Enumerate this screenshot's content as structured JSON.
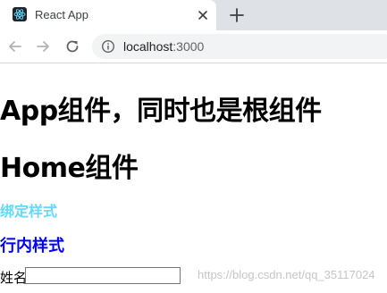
{
  "browser": {
    "tab": {
      "title": "React App",
      "favicon": "react-logo-icon"
    },
    "address_bar": {
      "host": "localhost",
      "port": ":3000"
    }
  },
  "page": {
    "app_heading": "App组件，同时也是根组件",
    "home_heading": "Home组件",
    "bound_style_text": "绑定样式",
    "inline_style_text": "行内样式",
    "name_label": "姓名",
    "name_value": "",
    "watermark": "https://blog.csdn.net/qq_35117024"
  },
  "colors": {
    "bound_style": "#61dafb",
    "inline_style": "#0000ff",
    "tabstrip": "#dee1e6"
  }
}
